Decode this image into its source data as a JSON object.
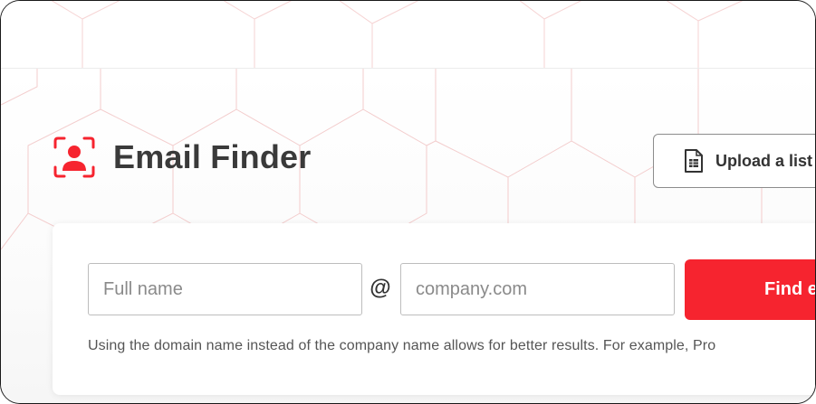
{
  "page": {
    "title": "Email Finder",
    "title_icon": "user-search-icon"
  },
  "upload": {
    "label": "Upload a list",
    "icon": "file-list-icon"
  },
  "form": {
    "name_placeholder": "Full name",
    "name_value": "",
    "at_symbol": "@",
    "domain_placeholder": "company.com",
    "domain_value": "",
    "find_button_label": "Find e"
  },
  "helper_text": "Using the domain name instead of the company name allows for better results. For example, Pro",
  "colors": {
    "accent": "#f6242f",
    "title_text": "#3a3a3a",
    "pattern_line": "#f3c9c9"
  }
}
